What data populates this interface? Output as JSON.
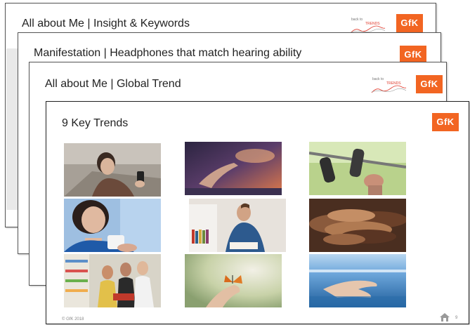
{
  "slides": [
    {
      "title": "All about Me | Insight & Keywords",
      "badge": "back to",
      "badge_sub": "TRENDS"
    },
    {
      "title": "Manifestation | Headphones that match hearing ability"
    },
    {
      "title": "All about Me | Global Trend",
      "badge": "back to",
      "badge_sub": "TRENDS"
    },
    {
      "title": "9 Key Trends"
    }
  ],
  "logo_text": "GfK",
  "footer": {
    "copyright": "© GfK 2018",
    "page": "9"
  },
  "colors": {
    "brand": "#f26522",
    "trends_accent": "#e0392b"
  },
  "photos": [
    {
      "name": "woman-with-phone"
    },
    {
      "name": "hand-touching-screen"
    },
    {
      "name": "bike-handlebar"
    },
    {
      "name": "woman-with-cup"
    },
    {
      "name": "man-reading-book"
    },
    {
      "name": "stacked-hands"
    },
    {
      "name": "pharmacy-shoppers"
    },
    {
      "name": "butterfly-on-hand"
    },
    {
      "name": "hand-over-sea"
    }
  ],
  "icons": {
    "home": "home-icon"
  }
}
